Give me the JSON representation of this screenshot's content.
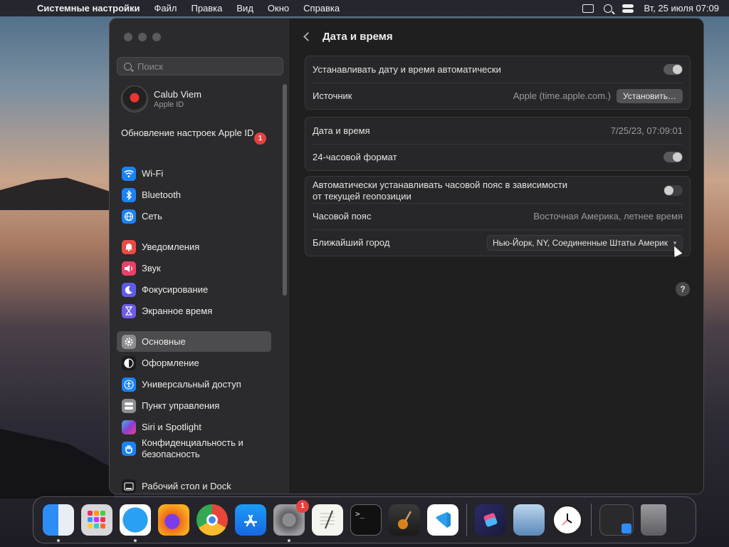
{
  "menubar": {
    "app_name": "Системные настройки",
    "menus": [
      "Файл",
      "Правка",
      "Вид",
      "Окно",
      "Справка"
    ],
    "clock": "Вт, 25 июля  07:09"
  },
  "sidebar": {
    "search_placeholder": "Поиск",
    "profile": {
      "name": "Calub Viem",
      "subtitle": "Apple ID"
    },
    "update_label": "Обновление настроек Apple ID",
    "update_badge": "1",
    "items": [
      {
        "label": "Wi-Fi",
        "icon": "wifi-icon",
        "color": "#1a82f7"
      },
      {
        "label": "Bluetooth",
        "icon": "bluetooth-icon",
        "color": "#1a82f7"
      },
      {
        "label": "Сеть",
        "icon": "globe-icon",
        "color": "#1a82f7"
      },
      {
        "label": "Уведомления",
        "icon": "bell-icon",
        "color": "#ea4a45"
      },
      {
        "label": "Звук",
        "icon": "speaker-icon",
        "color": "#ea3f6a"
      },
      {
        "label": "Фокусирование",
        "icon": "moon-icon",
        "color": "#5e5ce6"
      },
      {
        "label": "Экранное время",
        "icon": "hourglass-icon",
        "color": "#6e5ce6"
      },
      {
        "label": "Основные",
        "icon": "gear-icon",
        "color": "#8e8d90"
      },
      {
        "label": "Оформление",
        "icon": "appearance-icon",
        "color": "#1c1c1e"
      },
      {
        "label": "Универсальный доступ",
        "icon": "accessibility-icon",
        "color": "#1a82f7"
      },
      {
        "label": "Пункт управления",
        "icon": "control-center-icon",
        "color": "#8e8d90"
      },
      {
        "label": "Siri и Spotlight",
        "icon": "siri-icon",
        "color": "#8a3fcf"
      },
      {
        "label": "Конфиденциальность и безопасность",
        "icon": "hand-icon",
        "color": "#1a82f7"
      },
      {
        "label": "Рабочий стол и Dock",
        "icon": "dock-icon",
        "color": "#1c1c1e"
      }
    ]
  },
  "main": {
    "title": "Дата и время",
    "auto_datetime_label": "Устанавливать дату и время автоматически",
    "auto_datetime_on": true,
    "source_label": "Источник",
    "source_value": "Apple (time.apple.com.)",
    "set_button": "Установить…",
    "datetime_label": "Дата и время",
    "datetime_value": "7/25/23, 07:09:01",
    "format24_label": "24-часовой формат",
    "format24_on": true,
    "auto_tz_label_1": "Автоматически устанавливать часовой пояс в зависимости",
    "auto_tz_label_2": "от текущей геопозиции",
    "auto_tz_on": false,
    "timezone_label": "Часовой пояс",
    "timezone_value": "Восточная Америка, летнее время",
    "city_label": "Ближайший город",
    "city_value": "Нью-Йорк, NY, Соединенные Штаты Америк",
    "help": "?"
  },
  "dock": {
    "apps": [
      "Finder",
      "Launchpad",
      "Safari",
      "Firefox",
      "Chrome",
      "App Store",
      "System Settings",
      "TextEdit",
      "Terminal",
      "GarageBand",
      "VS Code",
      "Shortcuts",
      "Preview",
      "Clock",
      "Window",
      "Trash"
    ],
    "settings_badge": "1"
  }
}
